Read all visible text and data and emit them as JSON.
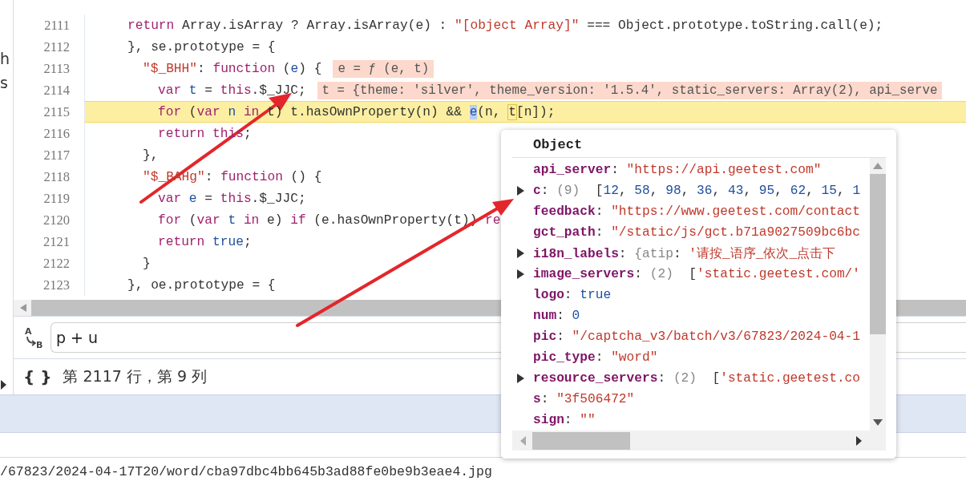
{
  "side_fragments": [
    "h",
    "s"
  ],
  "code_lines": [
    {
      "number": "2111",
      "highlighted": false,
      "tokens": [
        {
          "kind": "kw",
          "text": "return"
        },
        {
          "kind": "plain",
          "text": " Array.isArray ? Array.isArray(e) : "
        },
        {
          "kind": "str",
          "text": "\"[object Array]\""
        },
        {
          "kind": "plain",
          "text": " === Object.prototype.toString.call(e);"
        }
      ]
    },
    {
      "number": "2112",
      "highlighted": false,
      "tokens": [
        {
          "kind": "plain",
          "text": "}, se.prototype = {"
        }
      ],
      "children": [
        {
          "number": "2113",
          "highlighted": false,
          "tokens": [
            {
              "kind": "str",
              "text": "\"$_BHH\""
            },
            {
              "kind": "plain",
              "text": ": "
            },
            {
              "kind": "kw",
              "text": "function"
            },
            {
              "kind": "plain",
              "text": " ("
            },
            {
              "kind": "var",
              "text": "e"
            },
            {
              "kind": "plain",
              "text": ") {"
            }
          ],
          "inline_value": "e = ƒ (e, t)",
          "children": [
            {
              "number": "2114",
              "highlighted": false,
              "tokens": [
                {
                  "kind": "kw",
                  "text": "var"
                },
                {
                  "kind": "var",
                  "text": " t"
                },
                {
                  "kind": "plain",
                  "text": " = "
                },
                {
                  "kind": "kw",
                  "text": "this"
                },
                {
                  "kind": "plain",
                  "text": ".$_JJC;"
                }
              ],
              "inline_value": "t = {theme: 'silver', theme_version: '1.5.4', static_servers: Array(2), api_serve"
            },
            {
              "number": "2115",
              "highlighted": true,
              "tokens": [
                {
                  "kind": "kw",
                  "text": "for"
                },
                {
                  "kind": "plain",
                  "text": " ("
                },
                {
                  "kind": "kw",
                  "text": "var"
                },
                {
                  "kind": "var",
                  "text": " n"
                },
                {
                  "kind": "kw",
                  "text": " in"
                },
                {
                  "kind": "plain",
                  "text": " t) t.hasOwnProperty(n) && "
                },
                {
                  "kind": "sel",
                  "text": "e"
                },
                {
                  "kind": "plain",
                  "text": "(n, "
                },
                {
                  "kind": "box",
                  "text": "t"
                },
                {
                  "kind": "plain",
                  "text": "[n]);"
                }
              ]
            },
            {
              "number": "2116",
              "highlighted": false,
              "tokens": [
                {
                  "kind": "kw",
                  "text": "return"
                },
                {
                  "kind": "kw",
                  "text": " this"
                },
                {
                  "kind": "plain",
                  "text": ";"
                }
              ]
            }
          ]
        },
        {
          "number": "2117",
          "highlighted": false,
          "tokens": [
            {
              "kind": "plain",
              "text": "},"
            }
          ]
        },
        {
          "number": "2118",
          "highlighted": false,
          "tokens": [
            {
              "kind": "str",
              "text": "\"$_BAHg\""
            },
            {
              "kind": "plain",
              "text": ": "
            },
            {
              "kind": "kw",
              "text": "function"
            },
            {
              "kind": "plain",
              "text": " () {"
            }
          ],
          "children": [
            {
              "number": "2119",
              "highlighted": false,
              "tokens": [
                {
                  "kind": "kw",
                  "text": "var"
                },
                {
                  "kind": "var",
                  "text": " e"
                },
                {
                  "kind": "plain",
                  "text": " = "
                },
                {
                  "kind": "kw",
                  "text": "this"
                },
                {
                  "kind": "plain",
                  "text": ".$_JJC;"
                }
              ]
            },
            {
              "number": "2120",
              "highlighted": false,
              "tokens": [
                {
                  "kind": "kw",
                  "text": "for"
                },
                {
                  "kind": "plain",
                  "text": " ("
                },
                {
                  "kind": "kw",
                  "text": "var"
                },
                {
                  "kind": "var",
                  "text": " t"
                },
                {
                  "kind": "kw",
                  "text": " in"
                },
                {
                  "kind": "plain",
                  "text": " e) "
                },
                {
                  "kind": "kw",
                  "text": "if"
                },
                {
                  "kind": "plain",
                  "text": " (e.hasOwnProperty(t)) "
                },
                {
                  "kind": "kw",
                  "text": "re"
                }
              ]
            },
            {
              "number": "2121",
              "highlighted": false,
              "tokens": [
                {
                  "kind": "kw",
                  "text": "return"
                },
                {
                  "kind": "var",
                  "text": " true"
                },
                {
                  "kind": "plain",
                  "text": ";"
                }
              ]
            }
          ]
        },
        {
          "number": "2122",
          "highlighted": false,
          "tokens": [
            {
              "kind": "plain",
              "text": "}"
            }
          ]
        }
      ]
    },
    {
      "number": "2123",
      "highlighted": false,
      "tokens": [
        {
          "kind": "plain",
          "text": "}, oe.prototype = {"
        }
      ]
    }
  ],
  "popover": {
    "title": "Object",
    "properties": [
      {
        "expandable": false,
        "tokens": [
          {
            "kind": "key",
            "text": "api_server"
          },
          {
            "kind": "plain",
            "text": ": "
          },
          {
            "kind": "str",
            "text": "\"https://api.geetest.com\""
          }
        ]
      },
      {
        "expandable": true,
        "tokens": [
          {
            "kind": "key",
            "text": "c"
          },
          {
            "kind": "plain",
            "text": ": "
          },
          {
            "kind": "meta",
            "text": "(9)"
          },
          {
            "kind": "plain",
            "text": "  ["
          },
          {
            "kind": "num",
            "text": "12"
          },
          {
            "kind": "plain",
            "text": ", "
          },
          {
            "kind": "num",
            "text": "58"
          },
          {
            "kind": "plain",
            "text": ", "
          },
          {
            "kind": "num",
            "text": "98"
          },
          {
            "kind": "plain",
            "text": ", "
          },
          {
            "kind": "num",
            "text": "36"
          },
          {
            "kind": "plain",
            "text": ", "
          },
          {
            "kind": "num",
            "text": "43"
          },
          {
            "kind": "plain",
            "text": ", "
          },
          {
            "kind": "num",
            "text": "95"
          },
          {
            "kind": "plain",
            "text": ", "
          },
          {
            "kind": "num",
            "text": "62"
          },
          {
            "kind": "plain",
            "text": ", "
          },
          {
            "kind": "num",
            "text": "15"
          },
          {
            "kind": "plain",
            "text": ", "
          },
          {
            "kind": "num",
            "text": "1"
          }
        ]
      },
      {
        "expandable": false,
        "tokens": [
          {
            "kind": "key",
            "text": "feedback"
          },
          {
            "kind": "plain",
            "text": ": "
          },
          {
            "kind": "str",
            "text": "\"https://www.geetest.com/contact"
          }
        ]
      },
      {
        "expandable": false,
        "tokens": [
          {
            "kind": "key",
            "text": "gct_path"
          },
          {
            "kind": "plain",
            "text": ": "
          },
          {
            "kind": "str",
            "text": "\"/static/js/gct.b71a9027509bc6bc"
          }
        ]
      },
      {
        "expandable": true,
        "tokens": [
          {
            "kind": "key",
            "text": "i18n_labels"
          },
          {
            "kind": "plain",
            "text": ": "
          },
          {
            "kind": "meta",
            "text": "{atip"
          },
          {
            "kind": "plain",
            "text": ": "
          },
          {
            "kind": "str",
            "text": "'请按_语序_依次_点击下"
          }
        ]
      },
      {
        "expandable": true,
        "tokens": [
          {
            "kind": "key",
            "text": "image_servers"
          },
          {
            "kind": "plain",
            "text": ": "
          },
          {
            "kind": "meta",
            "text": "(2)"
          },
          {
            "kind": "plain",
            "text": "  ["
          },
          {
            "kind": "str",
            "text": "'static.geetest.com/'"
          }
        ]
      },
      {
        "expandable": false,
        "tokens": [
          {
            "kind": "key",
            "text": "logo"
          },
          {
            "kind": "plain",
            "text": ": "
          },
          {
            "kind": "num",
            "text": "true"
          }
        ]
      },
      {
        "expandable": false,
        "tokens": [
          {
            "kind": "key",
            "text": "num"
          },
          {
            "kind": "plain",
            "text": ": "
          },
          {
            "kind": "num",
            "text": "0"
          }
        ]
      },
      {
        "expandable": false,
        "tokens": [
          {
            "kind": "key",
            "text": "pic"
          },
          {
            "kind": "plain",
            "text": ": "
          },
          {
            "kind": "str",
            "text": "\"/captcha_v3/batch/v3/67823/2024-04-1"
          }
        ]
      },
      {
        "expandable": false,
        "tokens": [
          {
            "kind": "key",
            "text": "pic_type"
          },
          {
            "kind": "plain",
            "text": ": "
          },
          {
            "kind": "str",
            "text": "\"word\""
          }
        ]
      },
      {
        "expandable": true,
        "tokens": [
          {
            "kind": "key",
            "text": "resource_servers"
          },
          {
            "kind": "plain",
            "text": ": "
          },
          {
            "kind": "meta",
            "text": "(2)"
          },
          {
            "kind": "plain",
            "text": "  ["
          },
          {
            "kind": "str",
            "text": "'static.geetest.co"
          }
        ]
      },
      {
        "expandable": false,
        "tokens": [
          {
            "kind": "key",
            "text": "s"
          },
          {
            "kind": "plain",
            "text": ": "
          },
          {
            "kind": "str",
            "text": "\"3f506472\""
          }
        ]
      },
      {
        "expandable": false,
        "tokens": [
          {
            "kind": "key",
            "text": "sign"
          },
          {
            "kind": "plain",
            "text": ": "
          },
          {
            "kind": "str",
            "text": "\"\""
          }
        ]
      }
    ]
  },
  "expression": {
    "icon_from": "A",
    "icon_to": "B",
    "value": "p + u"
  },
  "status": {
    "icon": "{ }",
    "text": "第 2117 行，第 9 列"
  },
  "bottom_path": "/67823/2024-04-17T20/word/cba97dbc4bb645b3ad88fe0be9b3eae4.jpg"
}
